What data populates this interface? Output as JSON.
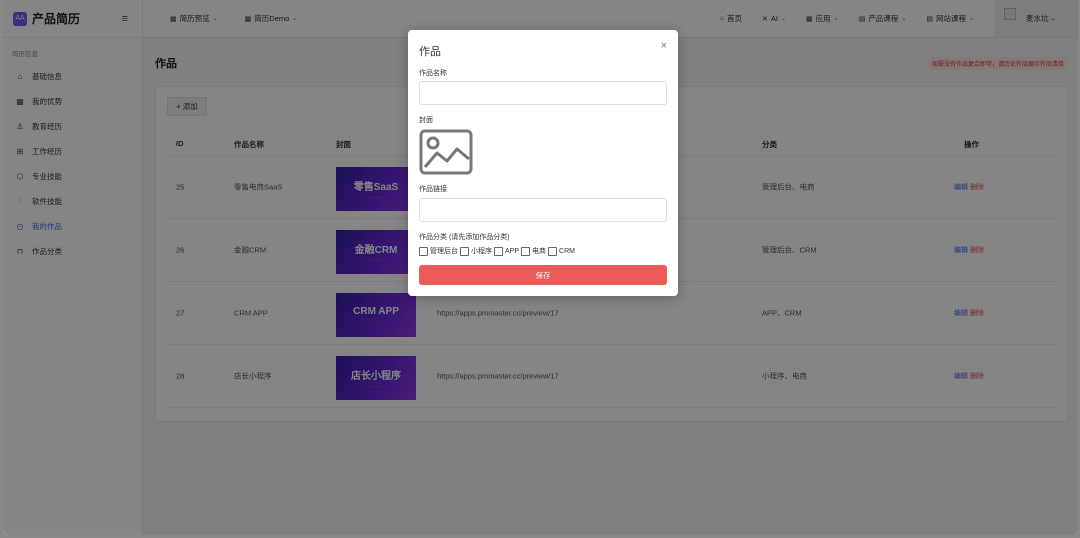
{
  "brand": {
    "name": "产品简历",
    "logo_text": "AA"
  },
  "sidebar": {
    "section_title": "简历信息",
    "items": [
      {
        "label": "基础信息",
        "icon": "home-icon",
        "glyph": "⌂"
      },
      {
        "label": "我的优势",
        "icon": "grid-icon",
        "glyph": "▦"
      },
      {
        "label": "教育经历",
        "icon": "users-icon",
        "glyph": "♙"
      },
      {
        "label": "工作经历",
        "icon": "gift-icon",
        "glyph": "⊞"
      },
      {
        "label": "专业技能",
        "icon": "cube-icon",
        "glyph": "⬡"
      },
      {
        "label": "软件技能",
        "icon": "sliders-icon",
        "glyph": "⫶"
      },
      {
        "label": "我的作品",
        "icon": "clock-icon",
        "glyph": "◷"
      },
      {
        "label": "作品分类",
        "icon": "shop-icon",
        "glyph": "⊓"
      }
    ]
  },
  "topbar": {
    "left": [
      {
        "label": "简历预览"
      },
      {
        "label": "简历Demo"
      }
    ],
    "right": [
      {
        "label": "首页"
      },
      {
        "label": "AI"
      },
      {
        "label": "应用"
      },
      {
        "label": "产品课程"
      },
      {
        "label": "网站课程"
      }
    ],
    "user_name": "麦水坑"
  },
  "page": {
    "title": "作品",
    "notice": "如需没有作品复合即可，请历史作品展示作品清单",
    "add_label": "+ 添加"
  },
  "table": {
    "headers": {
      "id": "ID",
      "name": "作品名称",
      "cover": "封面",
      "category": "分类",
      "actions": "操作"
    },
    "rows": [
      {
        "id": "25",
        "name": "零售电商SaaS",
        "cover_text": "零售SaaS",
        "link": "",
        "category": "管理后台、电商"
      },
      {
        "id": "26",
        "name": "金融CRM",
        "cover_text": "金融CRM",
        "link": "",
        "category": "管理后台、CRM"
      },
      {
        "id": "27",
        "name": "CRM APP",
        "cover_text": "CRM APP",
        "link": "https://apps.pmmaster.cc/preview/17",
        "category": "APP、CRM"
      },
      {
        "id": "28",
        "name": "店长小程序",
        "cover_text": "店长小程序",
        "link": "https://apps.pmmaster.cc/preview/17",
        "category": "小程序、电商"
      }
    ],
    "edit_label": "编辑",
    "delete_label": "删除"
  },
  "modal": {
    "title": "作品",
    "close": "×",
    "name_label": "作品名称",
    "name_value": "",
    "cover_label": "封面",
    "link_label": "作品链接",
    "link_value": "",
    "category_label": "作品分类 (请先添加作品分类)",
    "categories": [
      "管理后台",
      "小程序",
      "APP",
      "电商",
      "CRM"
    ],
    "save_label": "保存"
  },
  "colors": {
    "accent": "#3b6ef5",
    "danger": "#ec5a5a",
    "brand": "#6a5cf0"
  }
}
